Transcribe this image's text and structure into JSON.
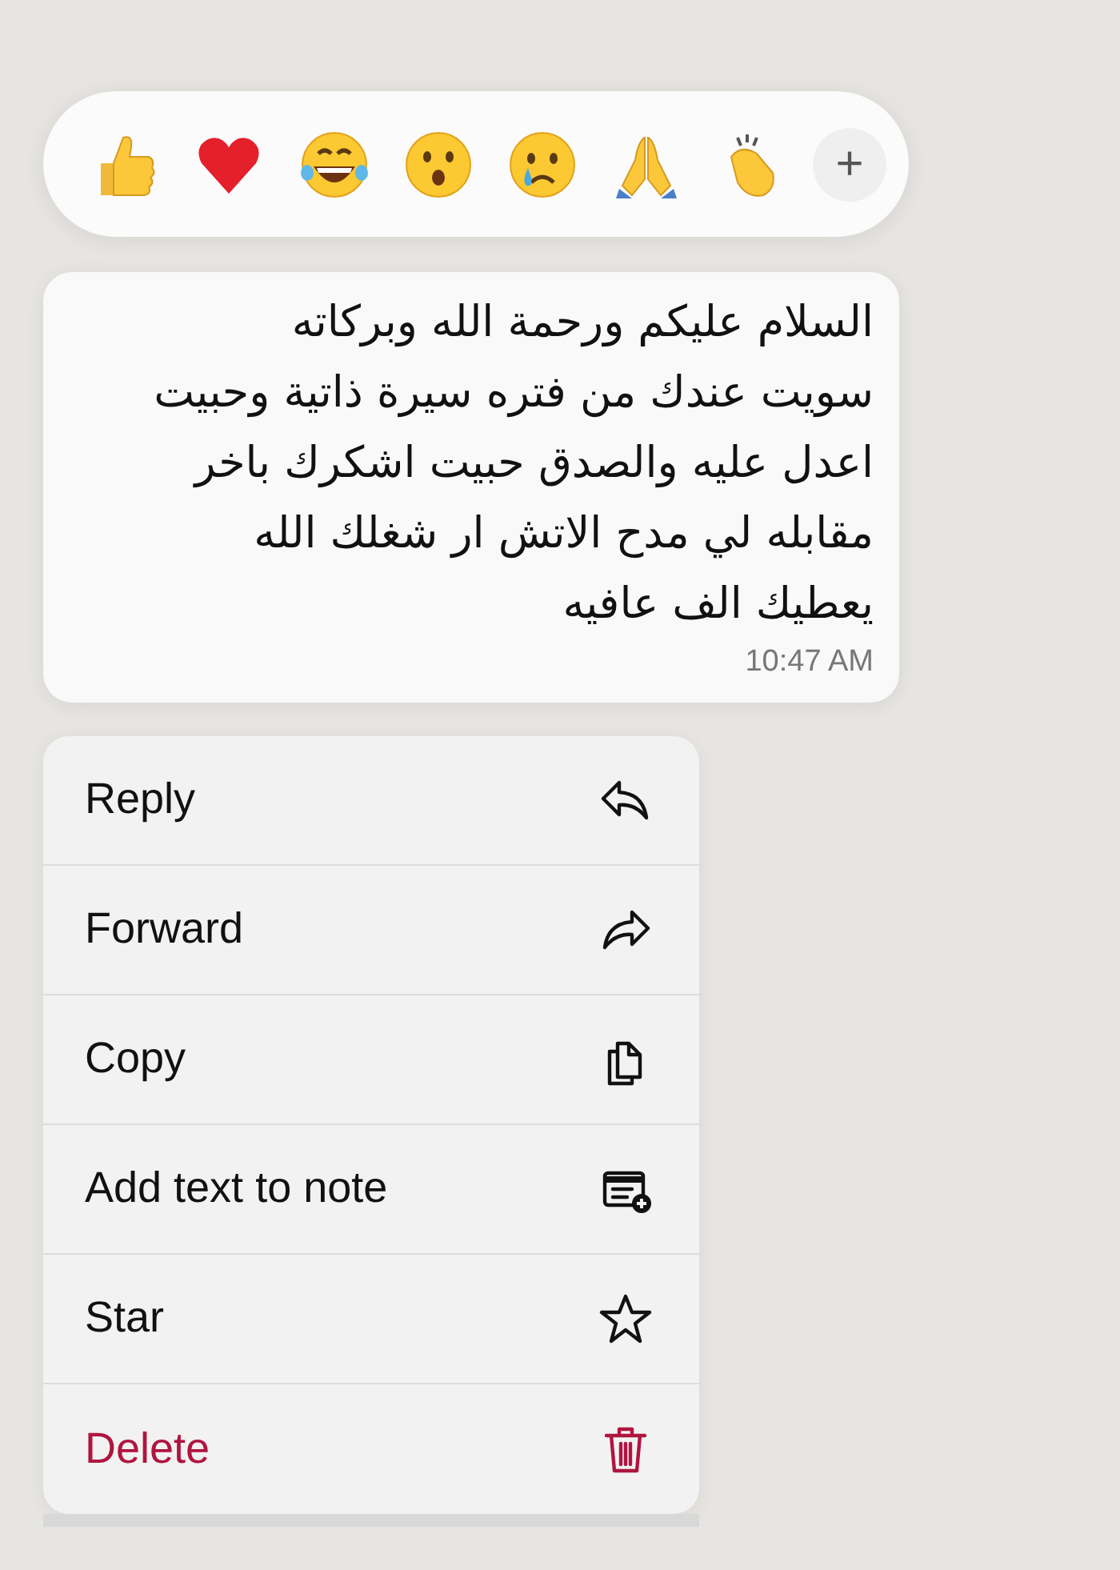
{
  "reactions": [
    {
      "kind": "thumbs-up"
    },
    {
      "kind": "heart"
    },
    {
      "kind": "laughing"
    },
    {
      "kind": "surprised"
    },
    {
      "kind": "crying"
    },
    {
      "kind": "praying"
    },
    {
      "kind": "clapping"
    }
  ],
  "more_reactions": {
    "label": "+"
  },
  "message": {
    "text": "السلام عليكم ورحمة الله وبركاته\nسويت عندك من فتره سيرة ذاتية وحبيت\nاعدل عليه والصدق حبيت اشكرك باخر\nمقابله لي مدح الاتش ار شغلك الله\nيعطيك الف عافيه",
    "time": "10:47 AM"
  },
  "menu": [
    {
      "label": "Reply",
      "kind": "reply",
      "destructive": false
    },
    {
      "label": "Forward",
      "kind": "forward",
      "destructive": false
    },
    {
      "label": "Copy",
      "kind": "copy",
      "destructive": false
    },
    {
      "label": "Add text to note",
      "kind": "note",
      "destructive": false
    },
    {
      "label": "Star",
      "kind": "star",
      "destructive": false
    },
    {
      "label": "Delete",
      "kind": "trash",
      "destructive": true
    }
  ]
}
